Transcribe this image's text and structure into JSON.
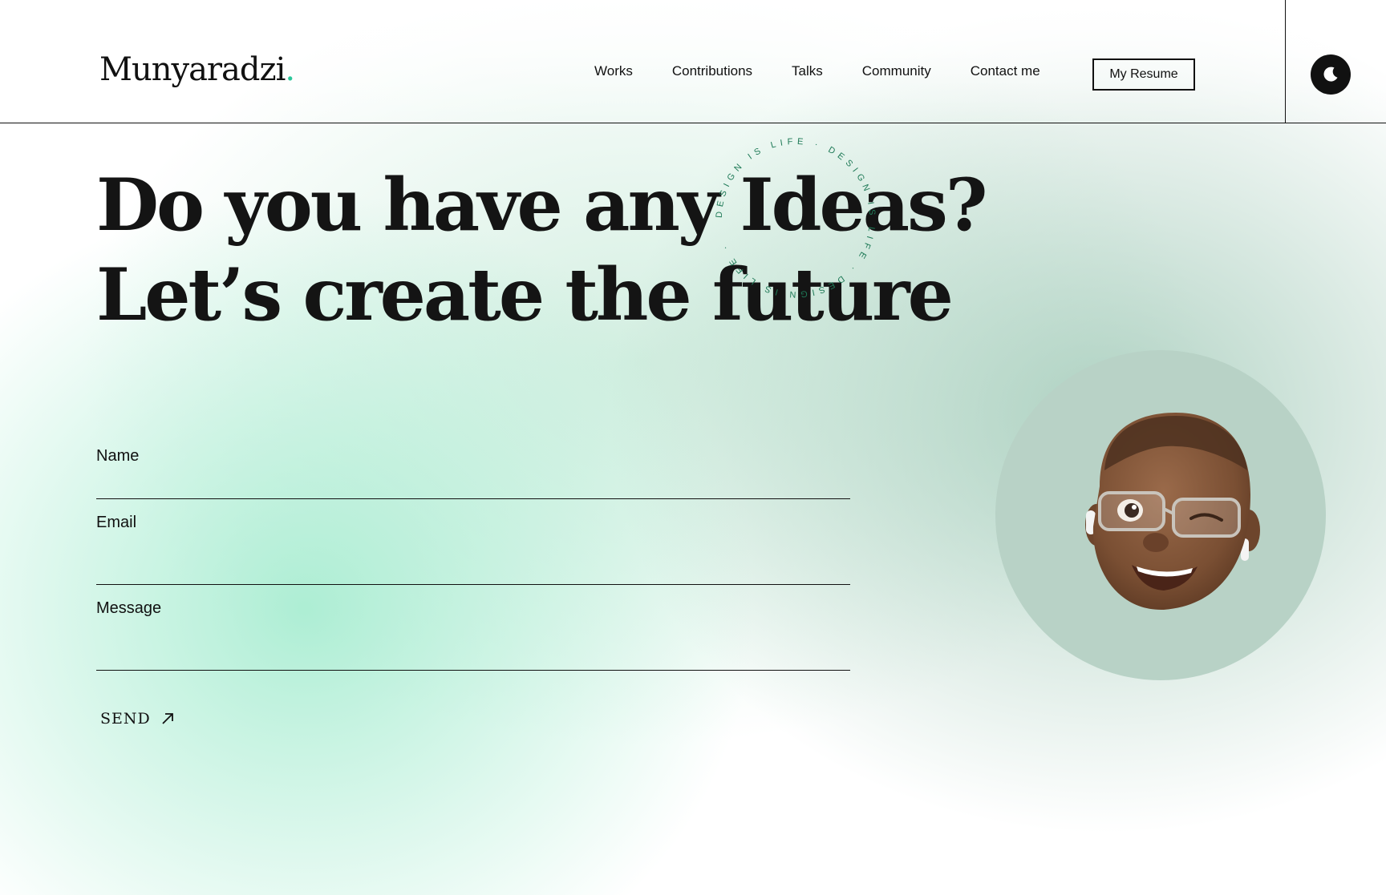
{
  "brand": {
    "name": "Munyaradzi",
    "dot": ".",
    "dot_color": "#2bc79a"
  },
  "nav": {
    "items": [
      {
        "label": "Works"
      },
      {
        "label": "Contributions"
      },
      {
        "label": "Talks"
      },
      {
        "label": "Community"
      },
      {
        "label": "Contact me"
      }
    ],
    "resume_label": "My Resume",
    "theme_icon": "moon-icon"
  },
  "hero": {
    "line1": "Do you have any Ideas?",
    "line2": "Let’s create the future",
    "badge_text": "DESIGN IS LIFE · DESIGN IS LIFE · DESIGN IS LIFE · "
  },
  "form": {
    "name_label": "Name",
    "email_label": "Email",
    "message_label": "Message",
    "name_value": "",
    "email_value": "",
    "message_value": "",
    "send_label": "SEND",
    "send_icon": "arrow-up-right-icon"
  },
  "avatar": {
    "icon": "memoji-avatar"
  },
  "colors": {
    "accent": "#2bc79a",
    "badge_text": "#1f7a57",
    "avatar_bg": "#b8d2c6",
    "text": "#111111"
  }
}
